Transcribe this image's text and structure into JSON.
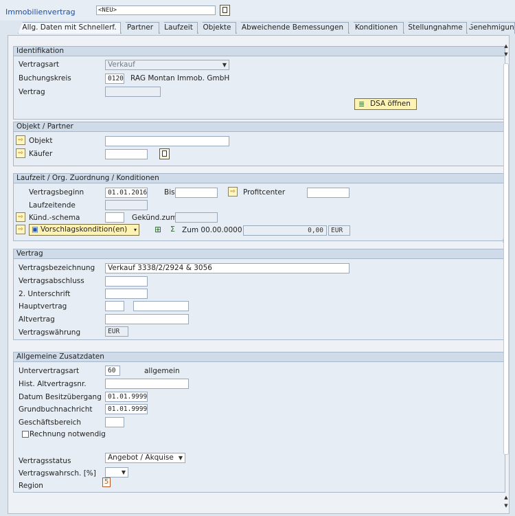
{
  "header": {
    "title": "Immobilienvertrag",
    "value": "<NEU>"
  },
  "tabs": [
    {
      "label": "Allg. Daten mit Schnellerf.",
      "active": true
    },
    {
      "label": "Partner"
    },
    {
      "label": "Laufzeit"
    },
    {
      "label": "Objekte"
    },
    {
      "label": "Abweichende Bemessungen"
    },
    {
      "label": "Konditionen"
    },
    {
      "label": "Stellungnahme"
    },
    {
      "label": "Genehmigun"
    }
  ],
  "identifikation": {
    "title": "Identifikation",
    "vertragsart_label": "Vertragsart",
    "vertragsart": "Verkauf",
    "buchungskreis_label": "Buchungskreis",
    "buchungskreis": "0120",
    "buchungskreis_text": "RAG Montan Immob. GmbH",
    "vertrag_label": "Vertrag",
    "vertrag": "",
    "dsa_button": "DSA öffnen"
  },
  "objekt_partner": {
    "title": "Objekt / Partner",
    "objekt_label": "Objekt",
    "objekt": "",
    "kaeufer_label": "Käufer",
    "kaeufer": ""
  },
  "laufzeit": {
    "title": "Laufzeit / Org. Zuordnung / Konditionen",
    "vertragsbeginn_label": "Vertragsbeginn",
    "vertragsbeginn": "01.01.2016",
    "bis_label": "Bis",
    "bis": "",
    "profitcenter_label": "Profitcenter",
    "profitcenter": "",
    "laufzeitende_label": "Laufzeitende",
    "laufzeitende": "",
    "kuend_label": "Künd.-schema",
    "kuend": "",
    "gekuend_label": "Gekünd.zum",
    "gekuend": "",
    "vorschlag_button": "Vorschlagskondition(en)",
    "zum_label": "Zum 00.00.0000",
    "amount": "0,00",
    "currency": "EUR"
  },
  "vertrag": {
    "title": "Vertrag",
    "bezeichnung_label": "Vertragsbezeichnung",
    "bezeichnung": "Verkauf 3338/2/2924 & 3056",
    "abschluss_label": "Vertragsabschluss",
    "abschluss": "",
    "unterschrift_label": "2. Unterschrift",
    "unterschrift": "",
    "hauptvertrag_label": "Hauptvertrag",
    "hauptvertrag": "",
    "altvertrag_label": "Altvertrag",
    "altvertrag": "",
    "waehrung_label": "Vertragswährung",
    "waehrung": "EUR"
  },
  "zusatz": {
    "title": "Allgemeine Zusatzdaten",
    "untervertragsart_label": "Untervertragsart",
    "untervertragsart": "60",
    "untervertragsart_text": "allgemein",
    "hist_label": "Hist. Altvertragsnr.",
    "hist": "",
    "besitz_label": "Datum Besitzübergang",
    "besitz": "01.01.9999",
    "grundbuch_label": "Grundbuchnachricht",
    "grundbuch": "01.01.9999",
    "geschaeftsbereich_label": "Geschäftsbereich",
    "geschaeftsbereich": "",
    "rechnung_label": "Rechnung notwendig",
    "status_label": "Vertragsstatus",
    "status": "Angebot / Akquise",
    "wahrsch_label": "Vertragswahrsch. [%]",
    "wahrsch": "",
    "region_label": "Region",
    "region_icon": "5"
  }
}
